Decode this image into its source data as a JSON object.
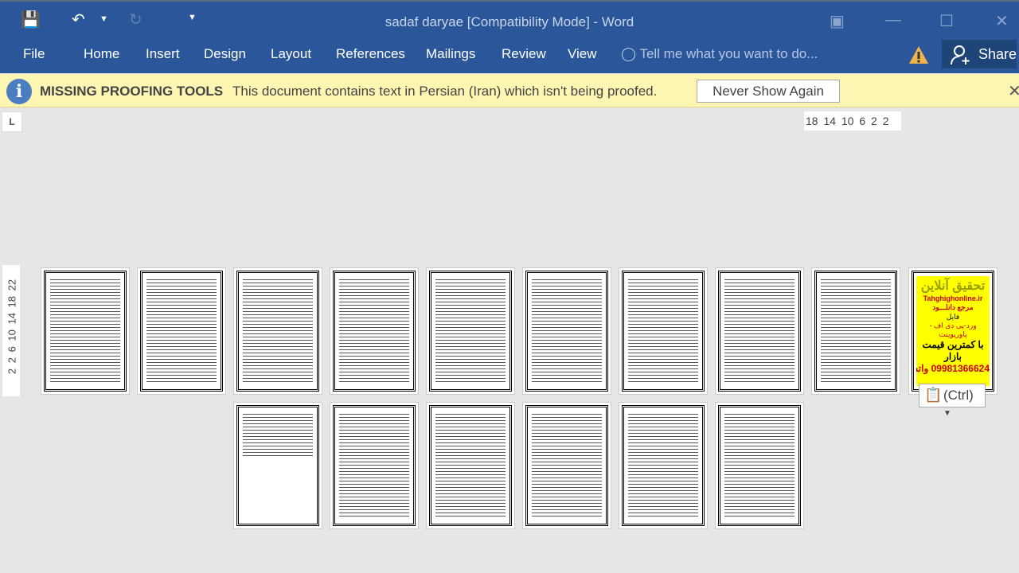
{
  "window": {
    "title": "sadaf daryae [Compatibility Mode] - Word"
  },
  "qat": {
    "save_icon": "save-icon",
    "undo_icon": "undo-icon",
    "redo_icon": "redo-icon"
  },
  "ribbon": {
    "tabs": [
      "File",
      "Home",
      "Insert",
      "Design",
      "Layout",
      "References",
      "Mailings",
      "Review",
      "View"
    ],
    "tell_me": "Tell me what you want to do...",
    "share": "Share"
  },
  "infobar": {
    "title": "MISSING PROOFING TOOLS",
    "message": "This document contains text in Persian (Iran) which isn't being proofed.",
    "button": "Never Show Again"
  },
  "ruler": {
    "horizontal": "18 14 10 6 2 2",
    "vertical": "2 2 6 10 14 18 22",
    "tab_selector": "L"
  },
  "ad_page": {
    "title": "تحقیق آنلاین",
    "site": "Tahghighonline.ir",
    "line1": "مرجع دانلـــود",
    "line2": "فایل",
    "line3": "ورد-پی دی اف - پاورپوینت",
    "line4": "با کمترین قیمت بازار",
    "line5": "09981366624 واتساپ"
  },
  "paste_options": {
    "label": "(Ctrl)"
  },
  "colors": {
    "ribbon": "#2b579a",
    "infobar": "#fcf6b2"
  }
}
